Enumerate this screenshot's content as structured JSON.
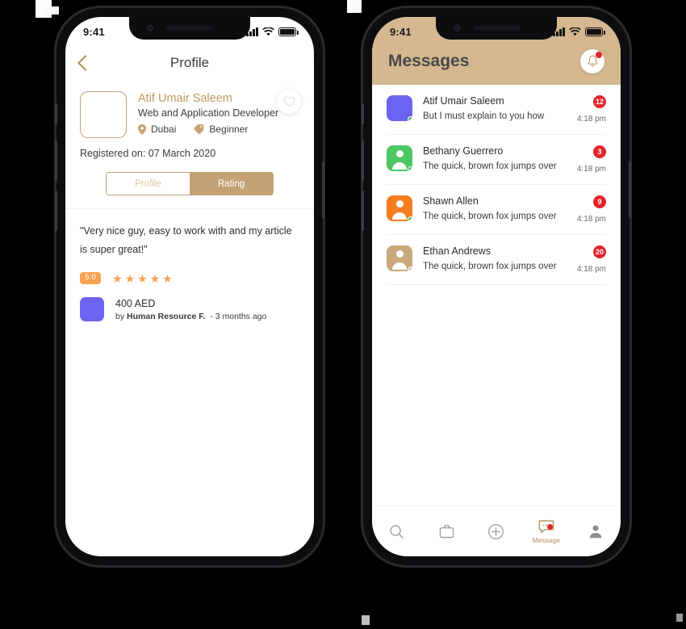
{
  "background_color": "#000000",
  "accent_gold": "#c4a276",
  "accent_orange": "#f7a253",
  "badge_red": "#e2262b",
  "left_phone": {
    "status_bar": {
      "time": "9:41",
      "signal_icon": "cellular-bars-icon",
      "wifi_icon": "wifi-icon",
      "battery_icon": "battery-full-icon"
    },
    "nav": {
      "back_icon": "back-chevron-icon",
      "title": "Profile"
    },
    "profile": {
      "avatar_placeholder": "avatar-placeholder",
      "name": "Atif Umair Saleem",
      "role": "Web and Application Developer",
      "location_icon": "location-pin-icon",
      "location": "Dubai",
      "level_icon": "tag-icon",
      "level": "Beginner",
      "favorite_icon": "heart-outline-icon",
      "registered": "Registered on: 07 March 2020"
    },
    "tabs": [
      {
        "label": "Profile",
        "active": false
      },
      {
        "label": "Rating",
        "active": true
      }
    ],
    "review": {
      "text": "\"Very nice guy, easy to work with and my article is super great!\"",
      "score": "5.0",
      "stars_filled": 5,
      "star_icon": "star-filled-icon",
      "job_thumb_color": "#6c63f0",
      "price": "400 AED",
      "by_prefix": "by",
      "by_name": "Human Resource F.",
      "time_ago": "- 3 months ago"
    }
  },
  "right_phone": {
    "status_bar": {
      "time": "9:41",
      "signal_icon": "cellular-bars-icon",
      "wifi_icon": "wifi-icon",
      "battery_icon": "battery-full-icon"
    },
    "header": {
      "title": "Messages",
      "bell_icon": "bell-icon",
      "header_color": "#d5b890"
    },
    "messages": [
      {
        "name": "Atif Umair Saleem",
        "preview": "But I must explain to you how",
        "badge": "12",
        "time": "4:18 pm",
        "avatar_color": "#6c63f0",
        "has_person_icon": false,
        "online": true
      },
      {
        "name": "Bethany Guerrero",
        "preview": "The quick, brown fox jumps over",
        "badge": "3",
        "time": "4:18 pm",
        "avatar_color": "#4cc764",
        "has_person_icon": true,
        "online": true
      },
      {
        "name": "Shawn Allen",
        "preview": "The quick, brown fox jumps over",
        "badge": "9",
        "time": "4:18 pm",
        "avatar_color": "#f57c1f",
        "has_person_icon": true,
        "online": true
      },
      {
        "name": "Ethan Andrews",
        "preview": "The quick, brown fox jumps over",
        "badge": "20",
        "time": "4:18 pm",
        "avatar_color": "#c9a87c",
        "has_person_icon": true,
        "online": false
      }
    ],
    "bottom_nav": [
      {
        "icon": "search-icon",
        "label": "",
        "active": false
      },
      {
        "icon": "briefcase-icon",
        "label": "",
        "active": false
      },
      {
        "icon": "plus-circle-icon",
        "label": "",
        "active": false
      },
      {
        "icon": "message-icon",
        "label": "Message",
        "active": true
      },
      {
        "icon": "person-icon",
        "label": "",
        "active": false
      }
    ]
  }
}
